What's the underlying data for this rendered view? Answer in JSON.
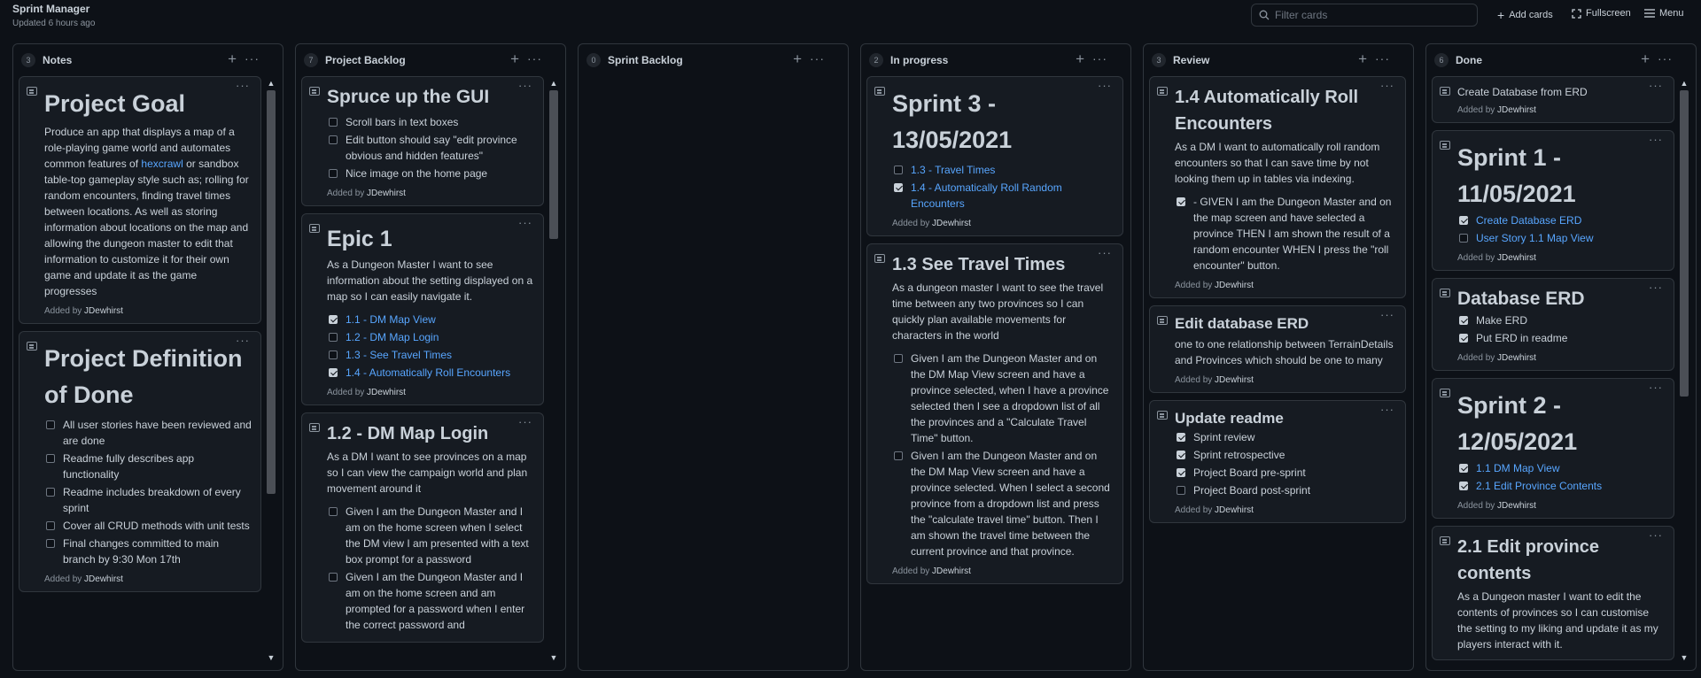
{
  "app": {
    "title": "Sprint Manager",
    "updated": "Updated 6 hours ago"
  },
  "toolbar": {
    "filter_placeholder": "Filter cards",
    "add_cards": "Add cards",
    "fullscreen": "Fullscreen",
    "menu": "Menu"
  },
  "added_prefix": "Added by",
  "columns": [
    {
      "name": "Notes",
      "count": "3",
      "cards": [
        {
          "title": "Project Goal",
          "desc_a": "Produce an app that displays a map of a role-playing game world and automates common features of ",
          "link": "hexcrawl",
          "desc_b": " or sandbox table-top gameplay style such as; rolling for random encounters, finding travel times between locations. As well as storing information about locations on the map and allowing the dungeon master to edit that information to customize it for their own game and update it as the game progresses",
          "author": "JDewhirst"
        },
        {
          "title": "Project Definition of Done",
          "checks": [
            "All user stories have been reviewed and are done",
            "Readme fully describes app functionality",
            "Readme includes breakdown of every sprint",
            "Cover all CRUD methods with unit tests",
            "Final changes committed to main branch by 9:30 Mon 17th"
          ],
          "author": "JDewhirst"
        }
      ]
    },
    {
      "name": "Project Backlog",
      "count": "7",
      "cards": [
        {
          "title": "Spruce up the GUI",
          "checks": [
            "Scroll bars in text boxes",
            "Edit button should say \"edit province obvious and hidden features\"",
            "Nice image on the home page"
          ],
          "author": "JDewhirst"
        },
        {
          "title": "Epic 1",
          "desc": "As a Dungeon Master I want to see information about the setting displayed on a map so I can easily navigate it.",
          "checks": [
            "1.1 - DM Map View",
            "1.2 - DM Map Login",
            "1.3 - See Travel Times",
            "1.4 - Automatically Roll Encounters"
          ],
          "author": "JDewhirst"
        },
        {
          "title": "1.2 - DM Map Login",
          "desc": "As a DM I want to see provinces on a map so I can view the campaign world and plan movement around it",
          "checks": [
            "Given I am the Dungeon Master and I am on the home screen when I select the DM view I am presented with a text box prompt for a password",
            "Given I am the Dungeon Master and I am on the home screen and am prompted for a password when I enter the correct password and"
          ]
        }
      ]
    },
    {
      "name": "Sprint Backlog",
      "count": "0",
      "cards": []
    },
    {
      "name": "In progress",
      "count": "2",
      "cards": [
        {
          "title": "Sprint 3 - 13/05/2021",
          "checks": [
            "1.3 - Travel Times",
            "1.4 - Automatically Roll Random Encounters"
          ],
          "author": "JDewhirst"
        },
        {
          "title": "1.3 See Travel Times",
          "desc": "As a dungeon master I want to see the travel time between any two provinces so I can quickly plan available movements for characters in the world",
          "checks": [
            "Given I am the Dungeon Master and on the DM Map View screen and have a province selected, when I have a province selected then I see a dropdown list of all the provinces and a \"Calculate Travel Time\" button.",
            "Given I am the Dungeon Master and on the DM Map View screen and have a province selected. When I select a second province from a dropdown list and press the \"calculate travel time\" button. Then I am shown the travel time between the current province and that province."
          ],
          "author": "JDewhirst"
        }
      ]
    },
    {
      "name": "Review",
      "count": "3",
      "cards": [
        {
          "title": "1.4 Automatically Roll Encounters",
          "desc": "As a DM I want to automatically roll random encounters so that I can save time by not looking them up in tables via indexing.",
          "checks": [
            "- GIVEN I am the Dungeon Master and on the map screen and have selected a province THEN I am shown the result of a random encounter WHEN I press the \"roll encounter\" button."
          ],
          "author": "JDewhirst"
        },
        {
          "title": "Edit database ERD",
          "desc": "one to one relationship between TerrainDetails and Provinces which should be one to many",
          "author": "JDewhirst"
        },
        {
          "title": "Update readme",
          "checks": [
            "Sprint review",
            "Sprint retrospective",
            "Project Board pre-sprint",
            "Project Board post-sprint"
          ],
          "author": "JDewhirst"
        }
      ]
    },
    {
      "name": "Done",
      "count": "6",
      "cards": [
        {
          "title": "Create Database from ERD",
          "author": "JDewhirst"
        },
        {
          "title": "Sprint 1 - 11/05/2021",
          "checks": [
            "Create Database ERD",
            "User Story 1.1 Map View"
          ],
          "author": "JDewhirst"
        },
        {
          "title": "Database ERD",
          "checks": [
            "Make ERD",
            "Put ERD in readme"
          ],
          "author": "JDewhirst"
        },
        {
          "title": "Sprint 2 - 12/05/2021",
          "checks": [
            "1.1 DM Map View",
            "2.1 Edit Province Contents"
          ],
          "author": "JDewhirst"
        },
        {
          "title": "2.1 Edit province contents",
          "desc": "As a Dungeon master I want to edit the contents of provinces so I can customise the setting to my liking and update it as my players interact with it."
        }
      ]
    }
  ]
}
